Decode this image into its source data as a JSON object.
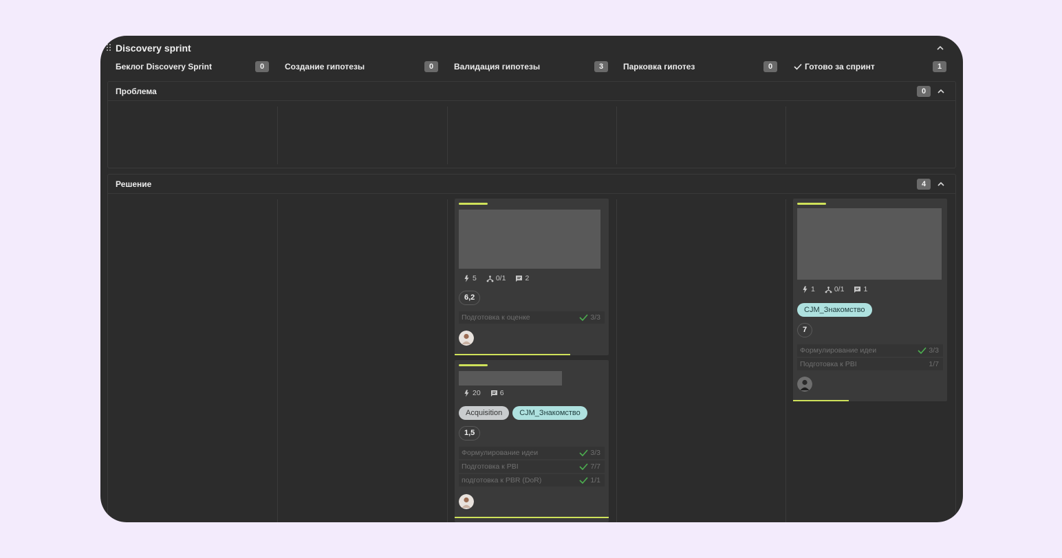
{
  "board": {
    "title": "Discovery sprint"
  },
  "columns": [
    {
      "name": "Беклог Discovery Sprint",
      "count": "0",
      "done": false
    },
    {
      "name": "Создание гипотезы",
      "count": "0",
      "done": false
    },
    {
      "name": "Валидация гипотезы",
      "count": "3",
      "done": false
    },
    {
      "name": "Парковка гипотез",
      "count": "0",
      "done": false
    },
    {
      "name": "Готово за спринт",
      "count": "1",
      "done": true
    }
  ],
  "lanes": [
    {
      "title": "Проблема",
      "count": "0"
    },
    {
      "title": "Решение",
      "count": "4"
    }
  ],
  "cards": [
    {
      "column": "Валидация гипотезы",
      "lane": "Решение",
      "efforts": "5",
      "subtasks": "0/1",
      "comments": "2",
      "tags": [],
      "score": "6,2",
      "checklists": [
        {
          "label": "Подготовка к оценке",
          "count": "3/3",
          "complete": true
        }
      ],
      "progress": 0.75
    },
    {
      "column": "Валидация гипотезы",
      "lane": "Решение",
      "efforts": "20",
      "subtasks": null,
      "comments": "6",
      "tags": [
        {
          "label": "Acquisition",
          "style": "grey"
        },
        {
          "label": "CJM_Знакомство",
          "style": "teal"
        }
      ],
      "score": "1,5",
      "checklists": [
        {
          "label": "Формулирование идеи",
          "count": "3/3",
          "complete": true
        },
        {
          "label": "Подготовка к PBI",
          "count": "7/7",
          "complete": true
        },
        {
          "label": "подготовка к PBR (DoR)",
          "count": "1/1",
          "complete": true
        }
      ],
      "progress": 1.0
    },
    {
      "column": "Готово за спринт",
      "lane": "Решение",
      "efforts": "1",
      "subtasks": "0/1",
      "comments": "1",
      "tags": [
        {
          "label": "CJM_Знакомство",
          "style": "teal"
        }
      ],
      "score": "7",
      "checklists": [
        {
          "label": "Формулирование идеи",
          "count": "3/3",
          "complete": true
        },
        {
          "label": "Подготовка к PBI",
          "count": "1/7",
          "complete": false
        }
      ],
      "progress": 0.36
    }
  ],
  "colors": {
    "background": "#f3ebfc",
    "board": "#2c2c2c",
    "card": "#3a3a3a",
    "accent": "#cfe25a",
    "check": "#4caf50",
    "tag_teal": "#aee1df",
    "tag_grey": "#c9ccce"
  },
  "icons": [
    "drag-handle-icon",
    "chevron-up-icon",
    "check-icon",
    "lightning-icon",
    "subtasks-icon",
    "comment-icon",
    "user-avatar"
  ]
}
